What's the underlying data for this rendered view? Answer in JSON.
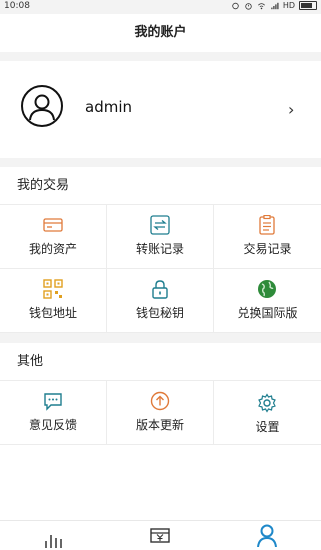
{
  "status_bar": {
    "time": "10:08",
    "network": "HD"
  },
  "header": {
    "title": "我的账户"
  },
  "account": {
    "username": "admin"
  },
  "sections": {
    "trade": {
      "title": "我的交易",
      "items": [
        {
          "label": "我的资产",
          "icon": "card-icon",
          "color": "#e07a3a"
        },
        {
          "label": "转账记录",
          "icon": "transfer-icon",
          "color": "#1f7e8f"
        },
        {
          "label": "交易记录",
          "icon": "clipboard-icon",
          "color": "#e07a3a"
        },
        {
          "label": "钱包地址",
          "icon": "qr-code-icon",
          "color": "#e0a020"
        },
        {
          "label": "钱包秘钥",
          "icon": "lock-icon",
          "color": "#1f7e8f"
        },
        {
          "label": "兑换国际版",
          "icon": "globe-icon",
          "color": "#2e8b3a"
        }
      ]
    },
    "other": {
      "title": "其他",
      "items": [
        {
          "label": "意见反馈",
          "icon": "chat-icon",
          "color": "#1f7e8f"
        },
        {
          "label": "版本更新",
          "icon": "upload-icon",
          "color": "#e07a3a"
        },
        {
          "label": "设置",
          "icon": "gear-icon",
          "color": "#1f7e8f"
        }
      ]
    }
  },
  "bottom_nav": [
    {
      "name": "market",
      "icon": "bar-chart-icon"
    },
    {
      "name": "wallet",
      "icon": "yuan-wallet-icon"
    },
    {
      "name": "account",
      "icon": "user-icon",
      "active_color": "#1e88c9"
    }
  ]
}
